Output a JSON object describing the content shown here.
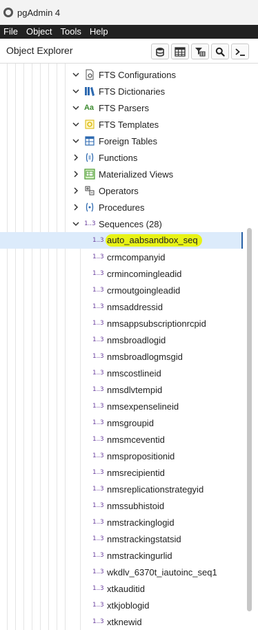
{
  "app": {
    "title": "pgAdmin 4"
  },
  "menu": [
    "File",
    "Object",
    "Tools",
    "Help"
  ],
  "panel": {
    "title": "Object Explorer",
    "toolbar": [
      "database-icon",
      "table-grid-icon",
      "filter-table-icon",
      "search-icon",
      "terminal-icon"
    ]
  },
  "tree": {
    "nodes": [
      {
        "label": "FTS Configurations",
        "icon": "fts-configuration-icon",
        "expanded": true
      },
      {
        "label": "FTS Dictionaries",
        "icon": "fts-dictionary-icon",
        "expanded": true
      },
      {
        "label": "FTS Parsers",
        "icon": "fts-parser-icon",
        "icon_text": "Aa",
        "expanded": true
      },
      {
        "label": "FTS Templates",
        "icon": "fts-template-icon",
        "expanded": true
      },
      {
        "label": "Foreign Tables",
        "icon": "foreign-table-icon",
        "expanded": true
      },
      {
        "label": "Functions",
        "icon": "function-icon",
        "expanded": false
      },
      {
        "label": "Materialized Views",
        "icon": "materialized-view-icon",
        "expanded": false
      },
      {
        "label": "Operators",
        "icon": "operator-icon",
        "expanded": false
      },
      {
        "label": "Procedures",
        "icon": "procedure-icon",
        "expanded": false
      },
      {
        "label": "Sequences (28)",
        "icon": "sequence-icon",
        "icon_text": "1..3",
        "expanded": true
      }
    ],
    "sequence_icon_text": "1..3",
    "selected": "auto_aabsandbox_seq",
    "sequences": [
      "auto_aabsandbox_seq",
      "crmcompanyid",
      "crmincomingleadid",
      "crmoutgoingleadid",
      "nmsaddressid",
      "nmsappsubscriptionrcpid",
      "nmsbroadlogid",
      "nmsbroadlogmsgid",
      "nmscostlineid",
      "nmsdlvtempid",
      "nmsexpenselineid",
      "nmsgroupid",
      "nmsmceventid",
      "nmspropositionid",
      "nmsrecipientid",
      "nmsreplicationstrategyid",
      "nmssubhistoid",
      "nmstrackinglogid",
      "nmstrackingstatsid",
      "nmstrackingurlid",
      "wkdlv_6370t_iautoinc_seq1",
      "xtkauditid",
      "xtkjoblogid",
      "xtknewid"
    ]
  },
  "colors": {
    "menubar": "#222222",
    "selection": "#dcebfb",
    "highlight": "#e8f316",
    "sequence_icon": "#6a3f9e"
  }
}
